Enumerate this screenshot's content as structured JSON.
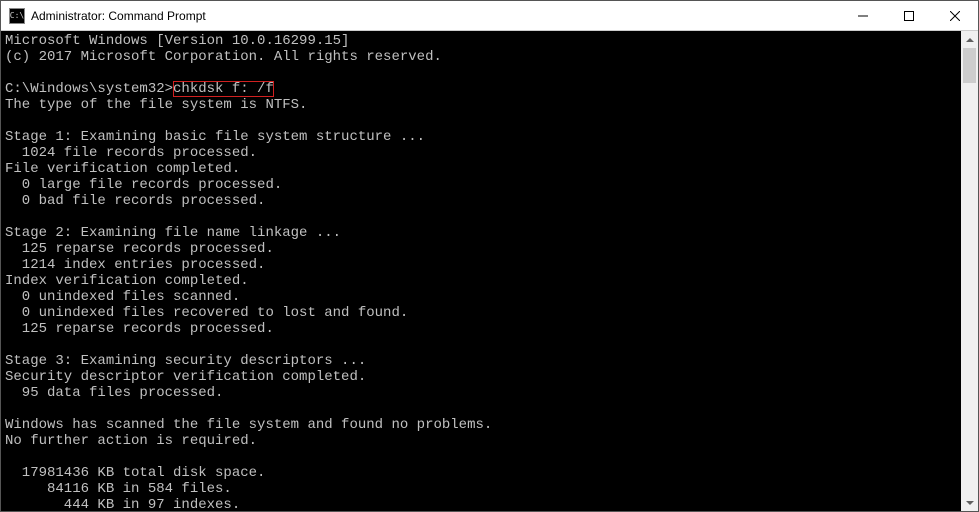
{
  "title": "Administrator: Command Prompt",
  "icon_glyph": "C:\\",
  "terminal": {
    "line_win_version": "Microsoft Windows [Version 10.0.16299.15]",
    "line_copyright": "(c) 2017 Microsoft Corporation. All rights reserved.",
    "blank": "",
    "prompt_prefix": "C:\\Windows\\system32>",
    "command": "chkdsk f: /f",
    "line_fs_type": "The type of the file system is NTFS.",
    "stage1_header": "Stage 1: Examining basic file system structure ...",
    "stage1_records": "  1024 file records processed.",
    "stage1_verif": "File verification completed.",
    "stage1_large": "  0 large file records processed.",
    "stage1_bad": "  0 bad file records processed.",
    "stage2_header": "Stage 2: Examining file name linkage ...",
    "stage2_reparse": "  125 reparse records processed.",
    "stage2_index": "  1214 index entries processed.",
    "stage2_verif": "Index verification completed.",
    "stage2_unidx_scan": "  0 unindexed files scanned.",
    "stage2_unidx_rec": "  0 unindexed files recovered to lost and found.",
    "stage2_reparse2": "  125 reparse records processed.",
    "stage3_header": "Stage 3: Examining security descriptors ...",
    "stage3_verif": "Security descriptor verification completed.",
    "stage3_data": "  95 data files processed.",
    "result_scanned": "Windows has scanned the file system and found no problems.",
    "result_noaction": "No further action is required.",
    "disk_total": "  17981436 KB total disk space.",
    "disk_files": "     84116 KB in 584 files.",
    "disk_indexes": "       444 KB in 97 indexes."
  }
}
